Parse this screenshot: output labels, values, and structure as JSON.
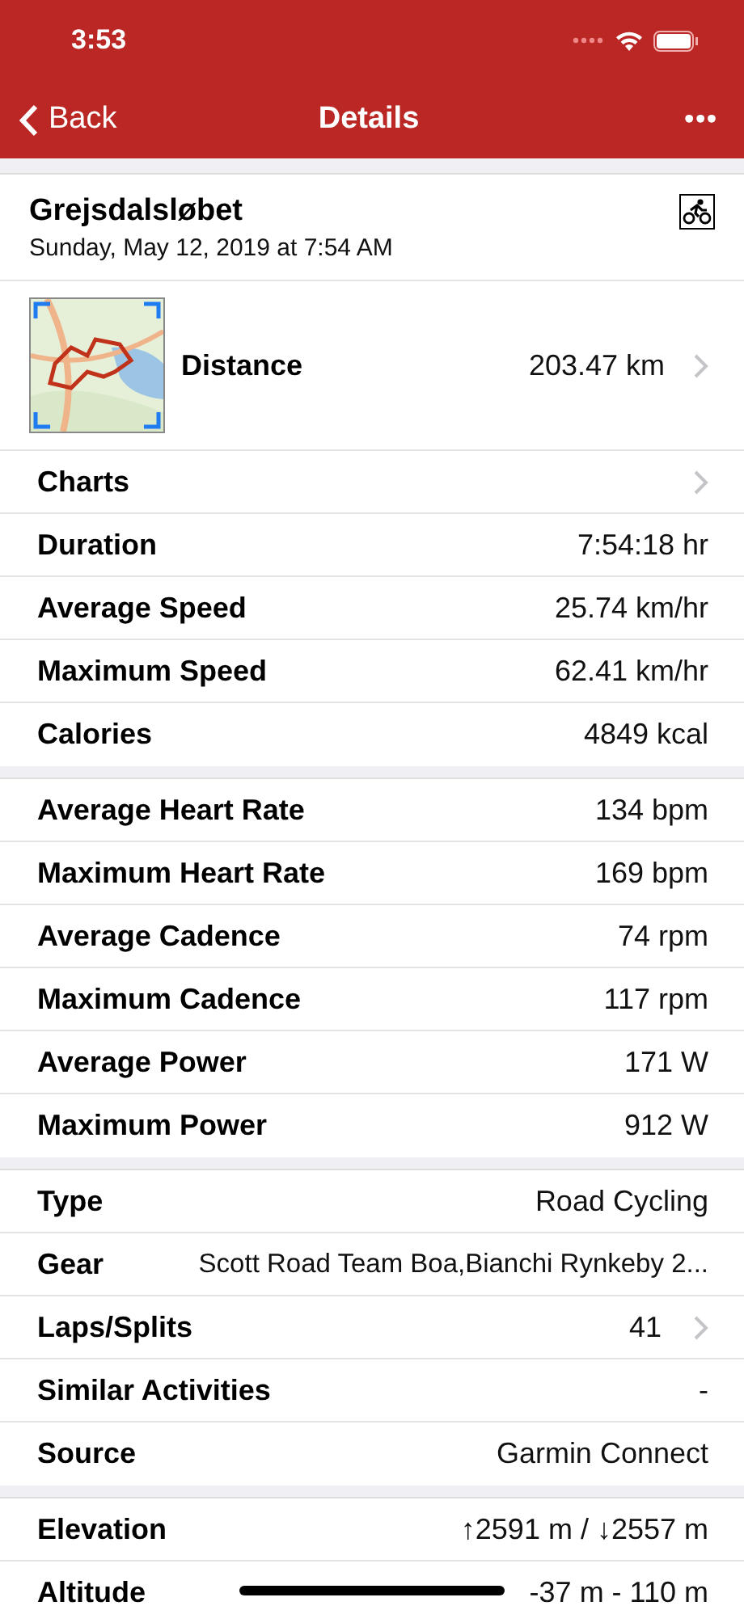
{
  "status_bar": {
    "time": "3:53"
  },
  "nav": {
    "back": "Back",
    "title": "Details",
    "more": "•••"
  },
  "activity": {
    "name": "Grejsdalsløbet",
    "date": "Sunday, May 12, 2019 at 7:54 AM"
  },
  "distance": {
    "label": "Distance",
    "value": "203.47 km",
    "disclosure": true
  },
  "sections": [
    {
      "rows": [
        {
          "label": "Charts",
          "value": "",
          "disclosure": true
        },
        {
          "label": "Duration",
          "value": "7:54:18 hr",
          "disclosure": false
        },
        {
          "label": "Average Speed",
          "value": "25.74 km/hr",
          "disclosure": false
        },
        {
          "label": "Maximum Speed",
          "value": "62.41 km/hr",
          "disclosure": false
        },
        {
          "label": "Calories",
          "value": "4849 kcal",
          "disclosure": false
        }
      ]
    },
    {
      "rows": [
        {
          "label": "Average Heart Rate",
          "value": "134 bpm",
          "disclosure": false
        },
        {
          "label": "Maximum Heart Rate",
          "value": "169 bpm",
          "disclosure": false
        },
        {
          "label": "Average Cadence",
          "value": "74 rpm",
          "disclosure": false
        },
        {
          "label": "Maximum Cadence",
          "value": "117 rpm",
          "disclosure": false
        },
        {
          "label": "Average Power",
          "value": "171 W",
          "disclosure": false
        },
        {
          "label": "Maximum Power",
          "value": "912 W",
          "disclosure": false
        }
      ]
    },
    {
      "rows": [
        {
          "label": "Type",
          "value": "Road Cycling",
          "disclosure": false
        },
        {
          "label": "Gear",
          "value": "Scott Road Team Boa,Bianchi Rynkeby 2...",
          "disclosure": false
        },
        {
          "label": "Laps/Splits",
          "value": "41",
          "disclosure": true
        },
        {
          "label": "Similar Activities",
          "value": "-",
          "disclosure": false
        },
        {
          "label": "Source",
          "value": "Garmin Connect",
          "disclosure": false
        }
      ]
    },
    {
      "rows": [
        {
          "label": "Elevation",
          "value": "↑2591 m / ↓2557 m",
          "disclosure": false
        },
        {
          "label": "Altitude",
          "value": "-37 m - 110 m",
          "disclosure": false
        }
      ]
    }
  ]
}
